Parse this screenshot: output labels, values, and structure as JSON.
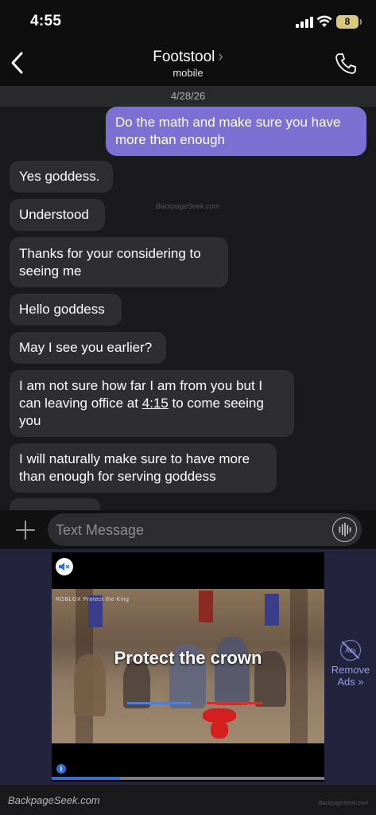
{
  "status_bar": {
    "time": "4:55",
    "battery": "8"
  },
  "header": {
    "contact_name": "Footstool",
    "subtitle": "mobile"
  },
  "date_divider": "4/28/26",
  "messages": [
    {
      "dir": "out",
      "text": "Do the math and make sure you have more than enough"
    },
    {
      "dir": "in",
      "text": "Yes goddess."
    },
    {
      "dir": "in",
      "text": "Understood"
    },
    {
      "dir": "in",
      "text": "Thanks for your considering to seeing me"
    },
    {
      "dir": "in",
      "text": "Hello goddess"
    },
    {
      "dir": "in",
      "text": "May I see you earlier?"
    },
    {
      "dir": "in",
      "text_before": "I am not sure how far I am from you but I can leaving office at ",
      "link": "4:15",
      "text_after": " to come seeing you"
    },
    {
      "dir": "in",
      "text": "I will naturally make sure to have more than enough for serving goddess"
    }
  ],
  "watermark_inline": "BackpageSeek.com",
  "composer": {
    "placeholder": "Text Message"
  },
  "ad": {
    "logo": "ROBLOX  Protect the King",
    "headline": "Protect the crown",
    "remove_icon_text": "Ads",
    "remove_label_1": "Remove",
    "remove_label_2": "Ads »",
    "progress": 0.25
  },
  "footer": {
    "watermark": "BackpageSeek.com",
    "watermark_small": "BackpageSeek.com"
  },
  "colors": {
    "outgoing_bubble": "#7d70d2",
    "incoming_bubble": "#2e2e31",
    "ad_background": "#24233d"
  }
}
